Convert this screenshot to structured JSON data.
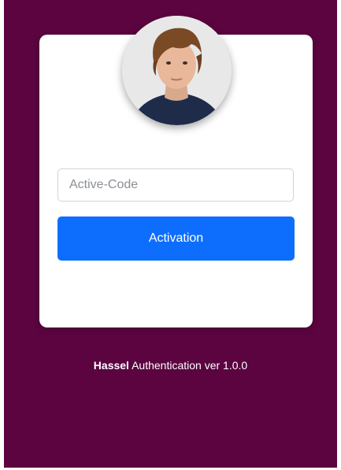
{
  "avatar": {
    "icon": "user-avatar-photo"
  },
  "form": {
    "code_placeholder": "Active-Code",
    "activation_label": "Activation"
  },
  "footer": {
    "brand": "Hassel",
    "text": "Authentication ver 1.0.0"
  },
  "colors": {
    "background": "#5b0440",
    "card": "#ffffff",
    "accent": "#0d6efd"
  }
}
